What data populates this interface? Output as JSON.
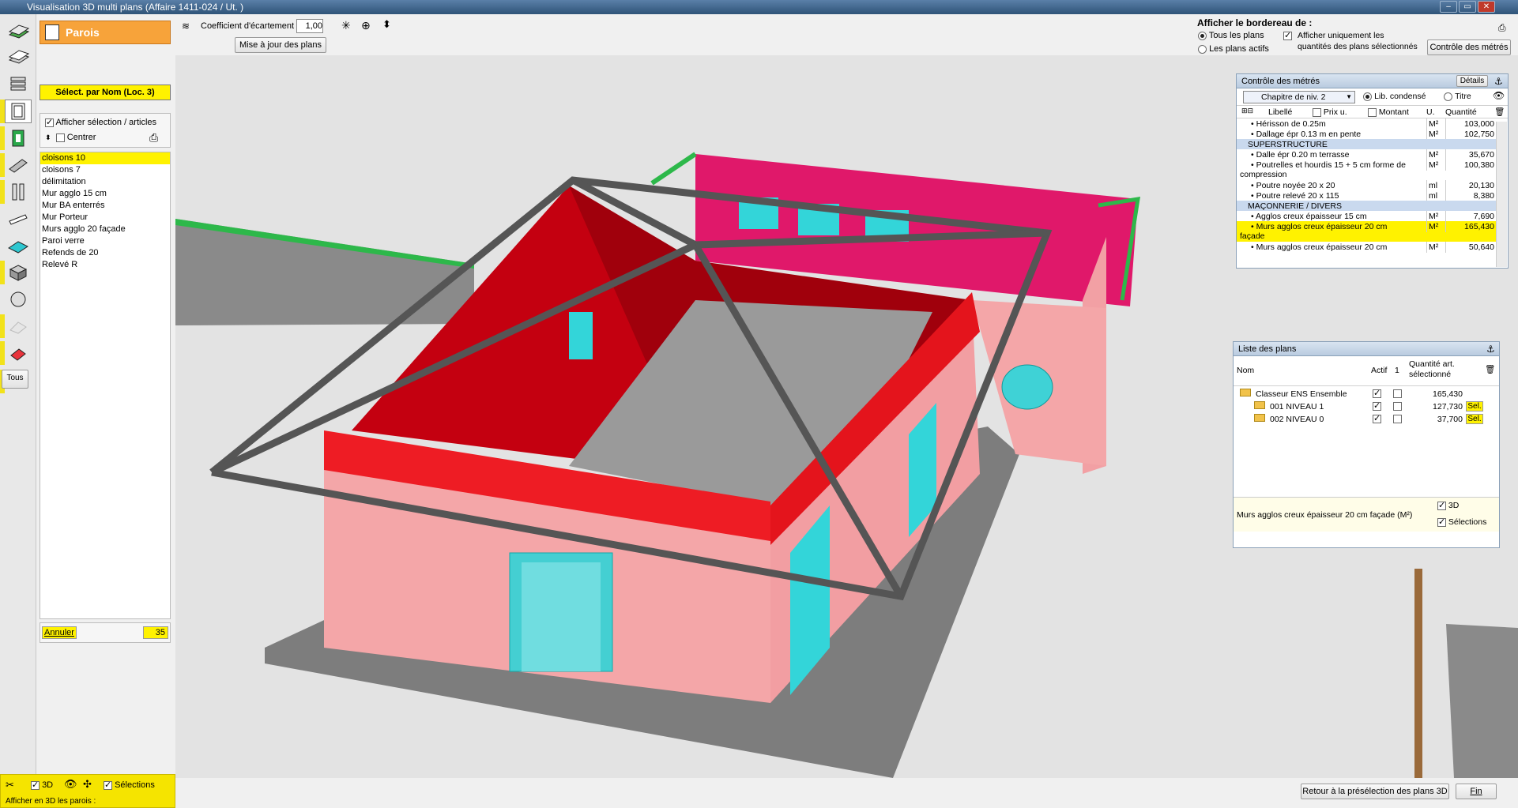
{
  "window": {
    "title": "Visualisation 3D multi plans   (Affaire 1411-024 / Ut.  )"
  },
  "topbar": {
    "coef_label": "Coefficient d'écartement",
    "coef_value": "1,00",
    "update_button": "Mise à jour des plans"
  },
  "left_panel": {
    "category_title": "Parois",
    "select_by_name": "Sélect. par Nom (Loc. 3)",
    "show_selection_label": "Afficher sélection / articles",
    "center_label": "Centrer",
    "walls": [
      "cloisons 10",
      "cloisons 7",
      "délimitation",
      "Mur agglo 15 cm",
      "Mur BA enterrés",
      "Mur Porteur",
      "Murs agglo 20 façade",
      "Paroi verre",
      "Refends de 20",
      "Relevé R"
    ],
    "cancel_button": "Annuler",
    "count": "35",
    "bottom": {
      "label_3d": "3D",
      "label_selections": "Sélections",
      "walls_3d_label": "Afficher en 3D les parois :"
    }
  },
  "left_toolbar": {
    "all_button": "Tous"
  },
  "bordereau": {
    "title": "Afficher le bordereau de :",
    "opt_all": "Tous les plans",
    "opt_active": "Les plans actifs",
    "only_qty_line1": "Afficher uniquement les",
    "only_qty_line2": "quantités des plans sélectionnés",
    "control_button": "Contrôle des métrés"
  },
  "controle_panel": {
    "header": "Contrôle des métrés",
    "details_button": "Détails",
    "chapter_select": "Chapitre de niv. 2",
    "lib_condense": "Lib. condensé",
    "titre": "Titre",
    "columns": {
      "libelle": "Libellé",
      "prix": "Prix u.",
      "montant": "Montant",
      "unite": "U.",
      "quantite": "Quantité"
    },
    "rows": [
      {
        "label": "• Hérisson de 0.25m",
        "unit": "M²",
        "qty": "103,000",
        "type": "item"
      },
      {
        "label": "• Dallage épr 0.13 m en pente",
        "unit": "M²",
        "qty": "102,750",
        "type": "item"
      },
      {
        "label": "SUPERSTRUCTURE",
        "unit": "",
        "qty": "",
        "type": "section"
      },
      {
        "label": "• Dalle épr 0.20 m terrasse",
        "unit": "M²",
        "qty": "35,670",
        "type": "item"
      },
      {
        "label": "• Poutrelles et hourdis 15 + 5 cm forme de",
        "label2": "compression",
        "unit": "M²",
        "qty": "100,380",
        "type": "item2"
      },
      {
        "label": "• Poutre noyée 20 x 20",
        "unit": "ml",
        "qty": "20,130",
        "type": "item"
      },
      {
        "label": "• Poutre relevé 20 x 115",
        "unit": "ml",
        "qty": "8,380",
        "type": "item"
      },
      {
        "label": "MAÇONNERIE / DIVERS",
        "unit": "",
        "qty": "",
        "type": "section"
      },
      {
        "label": "• Agglos creux épaisseur 15 cm",
        "unit": "M²",
        "qty": "7,690",
        "type": "item"
      },
      {
        "label": "• Murs agglos creux épaisseur 20 cm",
        "label2": "façade",
        "unit": "M²",
        "qty": "165,430",
        "type": "hl"
      },
      {
        "label": "• Murs agglos creux épaisseur 20 cm",
        "unit": "M²",
        "qty": "50,640",
        "type": "item"
      }
    ]
  },
  "plans_panel": {
    "header": "Liste des plans",
    "columns": {
      "nom": "Nom",
      "actif": "Actif",
      "one": "1",
      "qty_line1": "Quantité art.",
      "qty_line2": "sélectionné"
    },
    "rows": [
      {
        "name": "Classeur ENS Ensemble",
        "qty": "165,430",
        "sel": ""
      },
      {
        "name": "001 NIVEAU 1",
        "qty": "127,730",
        "sel": "Sel."
      },
      {
        "name": "002 NIVEAU 0",
        "qty": "37,700",
        "sel": "Sel."
      }
    ],
    "footer_text": "Murs agglos creux épaisseur 20 cm façade  (M²)",
    "opt_3d": "3D",
    "opt_selections": "Sélections"
  },
  "bottom_bar": {
    "return_button": "Retour à la présélection des plans 3D",
    "end_button": "Fin"
  },
  "colors": {
    "accent_orange": "#f7a33a",
    "highlight_yellow": "#fff200",
    "wall_red": "#e8141c",
    "wall_pink": "#f4a6a8",
    "glass_cyan": "#3fd2d6"
  }
}
